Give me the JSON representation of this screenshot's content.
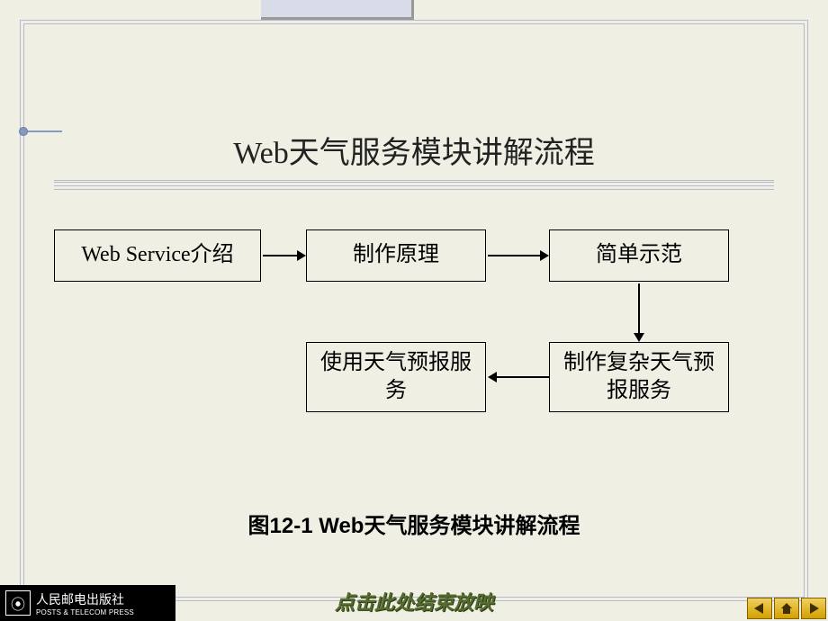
{
  "title": "Web天气服务模块讲解流程",
  "boxes": {
    "b1": "Web Service介绍",
    "b2": "制作原理",
    "b3": "简单示范",
    "b4": "制作复杂天气预报服务",
    "b5": "使用天气预报服务"
  },
  "caption": "图12-1  Web天气服务模块讲解流程",
  "publisher": {
    "zh": "人民邮电出版社",
    "en": "POSTS & TELECOM PRESS"
  },
  "end_link": "点击此处结束放映",
  "nav": {
    "prev": "上一页",
    "home": "首页",
    "next": "下一页"
  }
}
